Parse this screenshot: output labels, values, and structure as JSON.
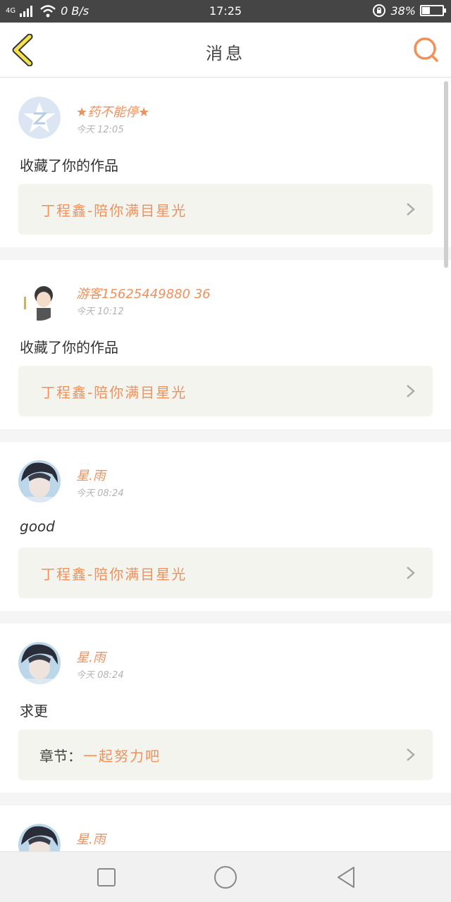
{
  "status_bar": {
    "network": "4G",
    "speed": "0 B/s",
    "time": "17:25",
    "battery": "38%",
    "battery_level": 0.38
  },
  "header": {
    "title": "消息",
    "back_icon": "chevron-left-icon",
    "search_icon": "search-icon"
  },
  "messages": [
    {
      "username": "★药不能停★",
      "time": "今天 12:05",
      "text": "收藏了你的作品",
      "link_prefix": "",
      "link_title": "丁程鑫-陪你满目星光"
    },
    {
      "username": "游客15625449880 36",
      "time": "今天 10:12",
      "text": "收藏了你的作品",
      "link_prefix": "",
      "link_title": "丁程鑫-陪你满目星光"
    },
    {
      "username": "星.雨",
      "time": "今天 08:24",
      "text": "good",
      "link_prefix": "",
      "link_title": "丁程鑫-陪你满目星光"
    },
    {
      "username": "星.雨",
      "time": "今天 08:24",
      "text": "求更",
      "link_prefix": "章节：",
      "link_title": "一起努力吧"
    },
    {
      "username": "星.雨"
    }
  ],
  "colors": {
    "accent": "#f2905a",
    "status_bar": "#454545",
    "link_bg": "#f4f4ee"
  },
  "nav": {
    "recents_icon": "square-icon",
    "home_icon": "circle-icon",
    "back_icon": "triangle-back-icon"
  }
}
